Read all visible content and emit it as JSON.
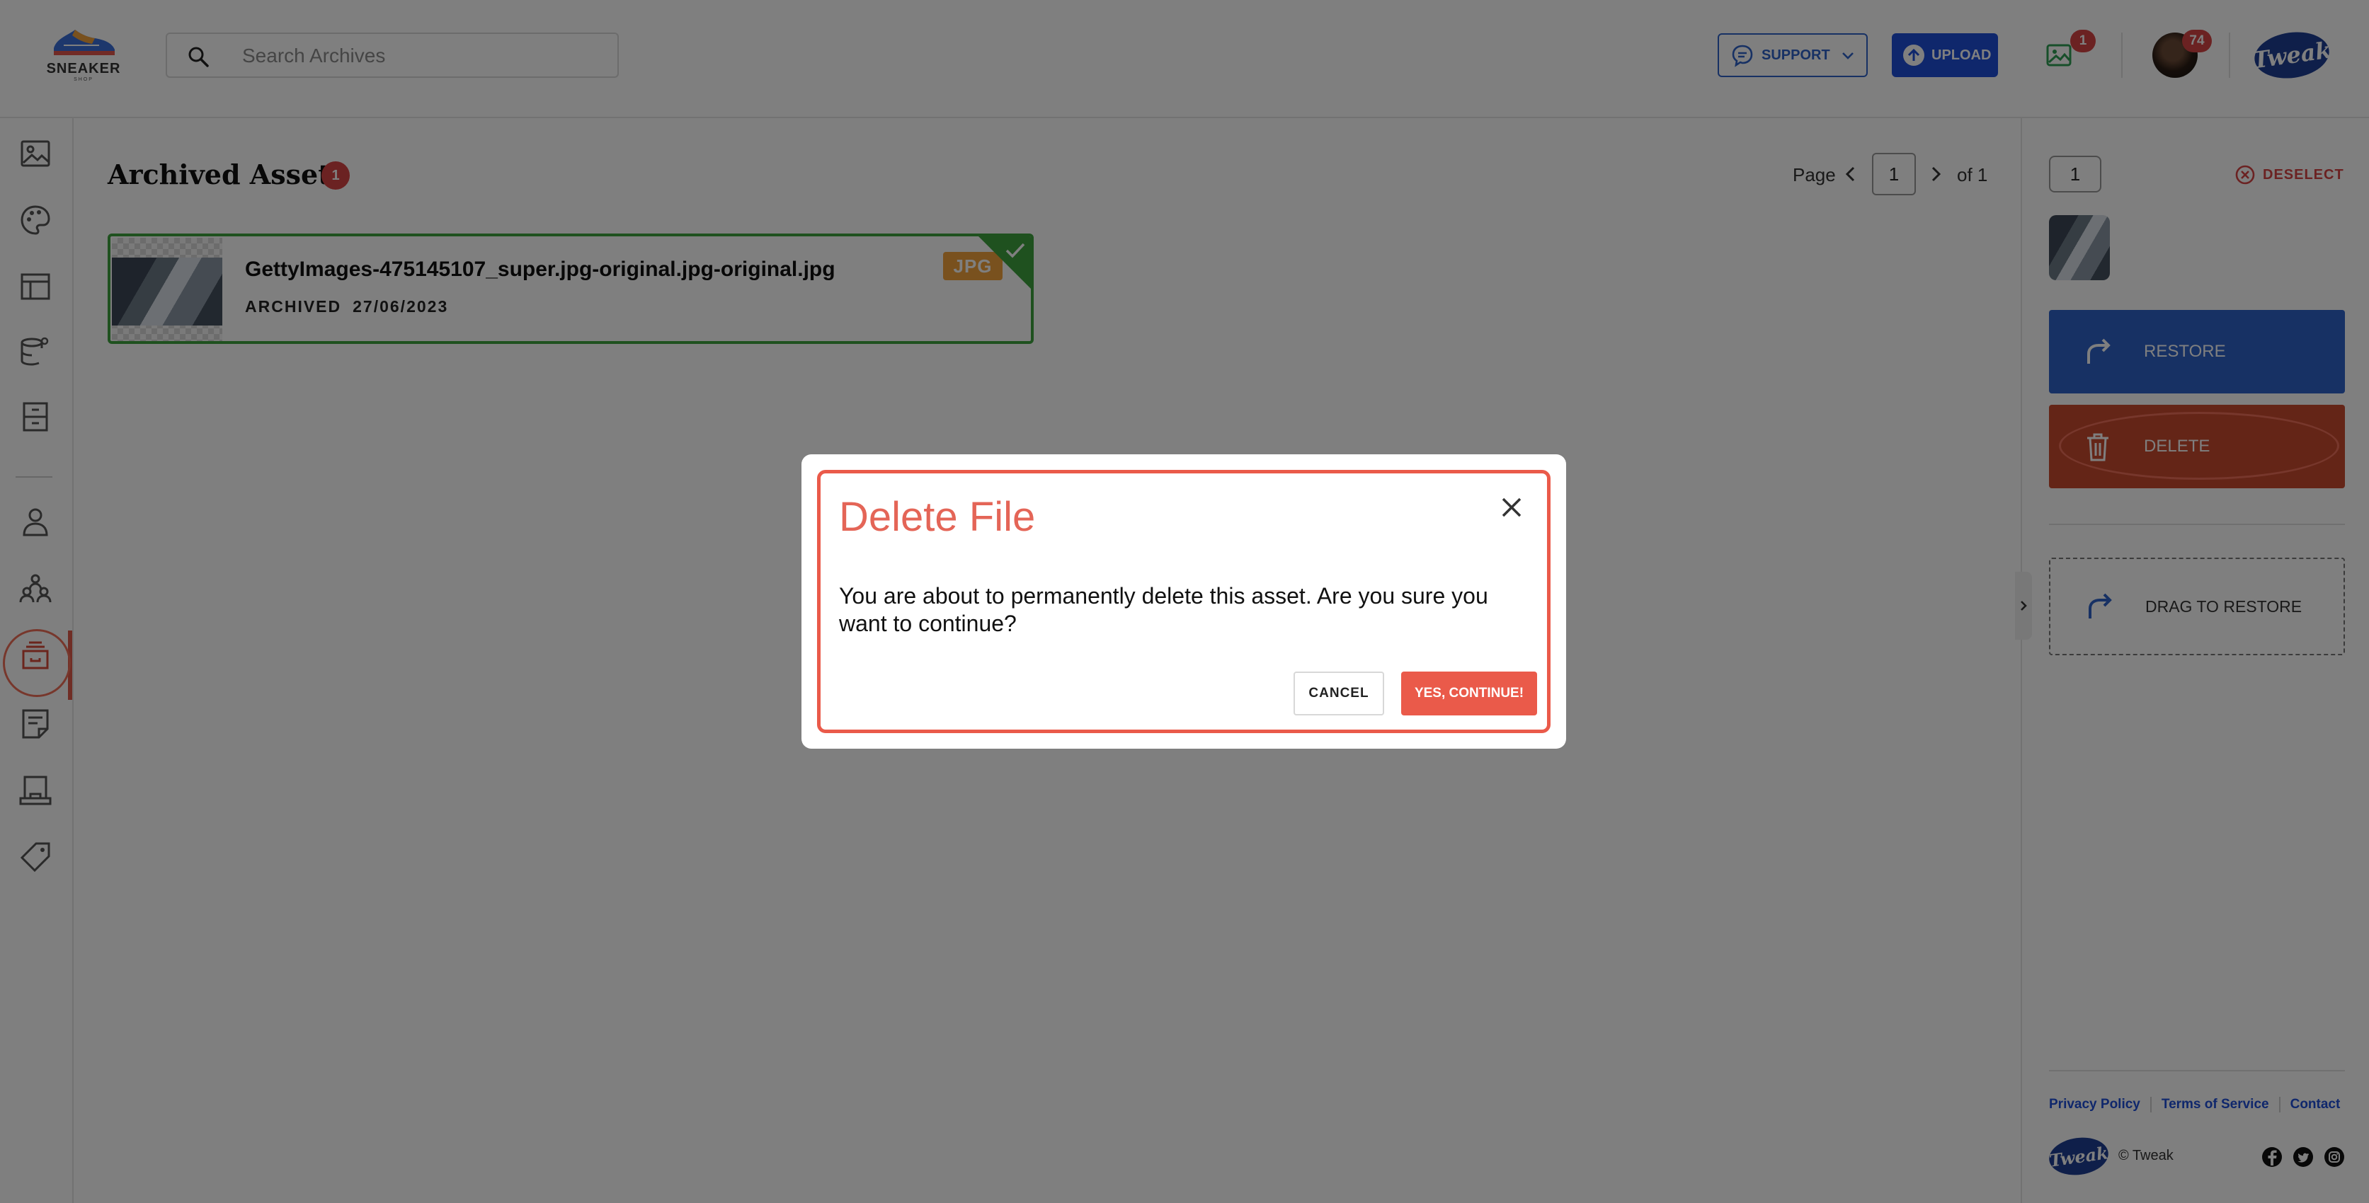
{
  "header": {
    "logo": {
      "word": "SNEAKER",
      "sub": "SHOP"
    },
    "search": {
      "placeholder": "Search Archives",
      "value": ""
    },
    "support_label": "SUPPORT",
    "upload_label": "UPLOAD",
    "notification_count": "1",
    "avatar_badge": "74",
    "brand_text": "Tweak"
  },
  "sidebar": {
    "items": [
      {
        "icon": "image-icon"
      },
      {
        "icon": "palette-icon"
      },
      {
        "icon": "layout-icon"
      },
      {
        "icon": "database-settings-icon"
      },
      {
        "icon": "cabinet-icon"
      },
      {
        "icon": "user-icon"
      },
      {
        "icon": "team-icon"
      },
      {
        "icon": "archive-icon",
        "active": true
      },
      {
        "icon": "note-icon"
      },
      {
        "icon": "inbox-icon"
      },
      {
        "icon": "tag-icon"
      }
    ]
  },
  "main": {
    "title": "Archived Assets",
    "count": "1",
    "pager": {
      "label": "Page",
      "current": "1",
      "of": "of 1"
    },
    "assets": [
      {
        "name": "GettyImages-475145107_super.jpg-original.jpg-original.jpg",
        "status": "ARCHIVED",
        "date": "27/06/2023",
        "type": "JPG",
        "selected": true
      }
    ]
  },
  "right_panel": {
    "selected_count": "1",
    "deselect_label": "DESELECT",
    "restore_label": "RESTORE",
    "delete_label": "DELETE",
    "drag_label": "DRAG TO RESTORE",
    "footer": {
      "links": [
        "Privacy Policy",
        "Terms of Service",
        "Contact"
      ],
      "copyright": "© Tweak",
      "brand_text": "Tweak",
      "social": [
        "facebook-icon",
        "twitter-icon",
        "instagram-icon"
      ]
    }
  },
  "modal": {
    "title": "Delete File",
    "message": "You are about to permanently delete this asset. Are you sure you want to continue?",
    "cancel_label": "CANCEL",
    "confirm_label": "YES, CONTINUE!"
  },
  "colors": {
    "accent_blue": "#1f4fd8",
    "danger_red": "#ea5a4a",
    "selected_green": "#3ea33e",
    "jpg_orange": "#f2a23c"
  }
}
